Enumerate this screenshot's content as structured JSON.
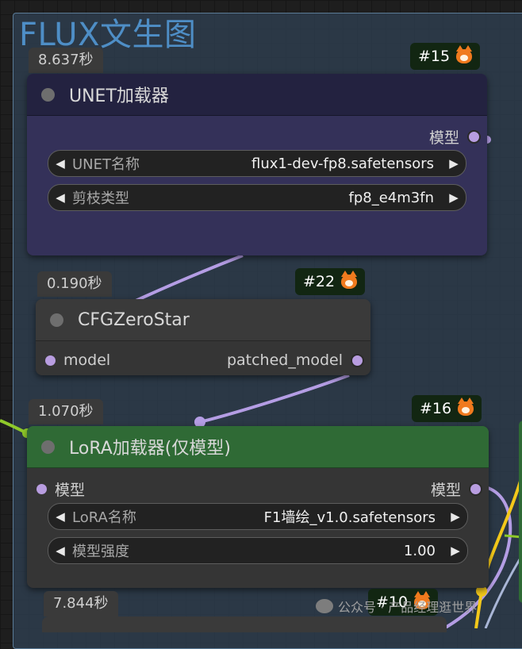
{
  "group": {
    "title": "FLUX文生图"
  },
  "nodes": {
    "unet": {
      "id": "#15",
      "timing": "8.637秒",
      "title": "UNET加载器",
      "output": "模型",
      "widgets": [
        {
          "label": "UNET名称",
          "value": "flux1-dev-fp8.safetensors"
        },
        {
          "label": "剪枝类型",
          "value": "fp8_e4m3fn"
        }
      ],
      "color": "#343159"
    },
    "cfg": {
      "id": "#22",
      "timing": "0.190秒",
      "title": "CFGZeroStar",
      "input": "model",
      "output": "patched_model"
    },
    "lora": {
      "id": "#16",
      "timing": "1.070秒",
      "title": "LoRA加载器(仅模型)",
      "input": "模型",
      "output": "模型",
      "widgets": [
        {
          "label": "LoRA名称",
          "value": "F1墙绘_v1.0.safetensors"
        },
        {
          "label": "模型强度",
          "value": "1.00"
        }
      ],
      "color": "#2f6a35"
    },
    "bottom": {
      "id": "#10",
      "timing": "7.844秒"
    }
  },
  "icons": {
    "badge_icon": "fox-icon",
    "prev": "◀",
    "next": "▶"
  },
  "watermark": "公众号 · 产品经理逛世界",
  "colors": {
    "wire_model": "#b49de4",
    "wire_clip": "#8fc92a",
    "wire_yellow": "#f3c81a"
  }
}
